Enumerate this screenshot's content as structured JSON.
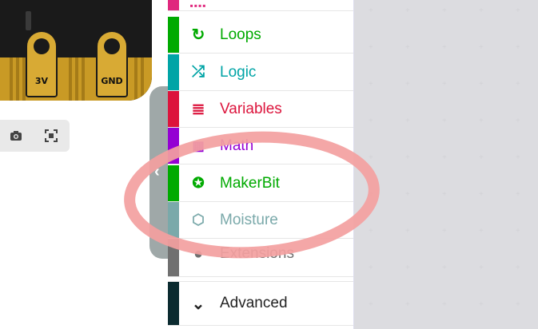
{
  "simulator": {
    "pins": [
      "3V",
      "GND"
    ],
    "buttons": [
      {
        "icon": "camera-icon"
      },
      {
        "icon": "fullscreen-icon"
      }
    ]
  },
  "toolbox": {
    "categories": [
      {
        "label": "",
        "icon": "partial-icon",
        "color": "#e0287e"
      },
      {
        "label": "Loops",
        "icon": "loop-icon",
        "color": "#00aa00"
      },
      {
        "label": "Logic",
        "icon": "shuffle-icon",
        "color": "#00a4a6"
      },
      {
        "label": "Variables",
        "icon": "list-icon",
        "color": "#dc143c"
      },
      {
        "label": "Math",
        "icon": "calculator-icon",
        "color": "#9400d3"
      },
      {
        "label": "MakerBit",
        "icon": "star-badge-icon",
        "color": "#00aa00"
      },
      {
        "label": "Moisture",
        "icon": "hexagon-icon",
        "color": "#7aa9aa"
      },
      {
        "label": "Extensions",
        "icon": "plus-circle-icon",
        "color": "#707070"
      },
      {
        "label": "Advanced",
        "icon": "chevron-down-icon",
        "color": "#0b2b30"
      }
    ]
  },
  "annotation": {
    "color": "#f3a0a0"
  }
}
